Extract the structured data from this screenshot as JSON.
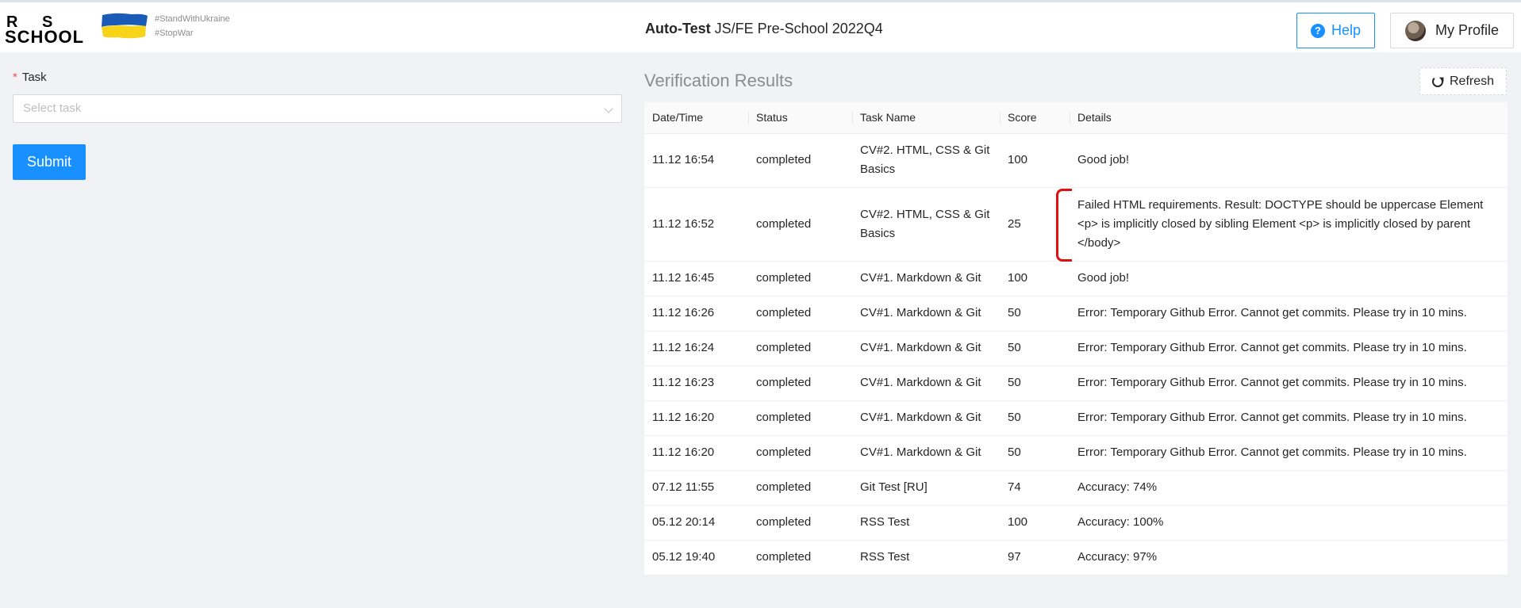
{
  "header": {
    "logo": {
      "r": "R",
      "s": "S",
      "school": "SCHOOL"
    },
    "tags": [
      "#StandWithUkraine",
      "#StopWar"
    ],
    "title_bold": "Auto-Test",
    "title_rest": " JS/FE Pre-School 2022Q4",
    "help_label": "Help",
    "help_icon_text": "?",
    "profile_label": "My Profile",
    "colors": {
      "accent": "#1890ff",
      "flag_blue": "#1a5bb8",
      "flag_yellow": "#f7d417"
    }
  },
  "form": {
    "required_mark": "*",
    "task_label": "Task",
    "task_placeholder": "Select task",
    "submit_label": "Submit"
  },
  "results": {
    "title": "Verification Results",
    "refresh_label": "Refresh",
    "columns": [
      "Date/Time",
      "Status",
      "Task Name",
      "Score",
      "Details"
    ],
    "rows": [
      {
        "date": "11.12 16:54",
        "status": "completed",
        "task": "CV#2. HTML, CSS & Git Basics",
        "score": "100",
        "details": "Good job!"
      },
      {
        "date": "11.12 16:52",
        "status": "completed",
        "task": "CV#2. HTML, CSS & Git Basics",
        "score": "25",
        "details": "Failed HTML requirements. Result: DOCTYPE should be uppercase Element <p> is implicitly closed by sibling Element <p> is implicitly closed by parent </body>"
      },
      {
        "date": "11.12 16:45",
        "status": "completed",
        "task": "CV#1. Markdown & Git",
        "score": "100",
        "details": "Good job!"
      },
      {
        "date": "11.12 16:26",
        "status": "completed",
        "task": "CV#1. Markdown & Git",
        "score": "50",
        "details": "Error: Temporary Github Error. Cannot get commits. Please try in 10 mins."
      },
      {
        "date": "11.12 16:24",
        "status": "completed",
        "task": "CV#1. Markdown & Git",
        "score": "50",
        "details": "Error: Temporary Github Error. Cannot get commits. Please try in 10 mins."
      },
      {
        "date": "11.12 16:23",
        "status": "completed",
        "task": "CV#1. Markdown & Git",
        "score": "50",
        "details": "Error: Temporary Github Error. Cannot get commits. Please try in 10 mins."
      },
      {
        "date": "11.12 16:20",
        "status": "completed",
        "task": "CV#1. Markdown & Git",
        "score": "50",
        "details": "Error: Temporary Github Error. Cannot get commits. Please try in 10 mins."
      },
      {
        "date": "11.12 16:20",
        "status": "completed",
        "task": "CV#1. Markdown & Git",
        "score": "50",
        "details": "Error: Temporary Github Error. Cannot get commits. Please try in 10 mins."
      },
      {
        "date": "07.12 11:55",
        "status": "completed",
        "task": "Git Test [RU]",
        "score": "74",
        "details": "Accuracy: 74%"
      },
      {
        "date": "05.12 20:14",
        "status": "completed",
        "task": "RSS Test",
        "score": "100",
        "details": "Accuracy: 100%"
      },
      {
        "date": "05.12 19:40",
        "status": "completed",
        "task": "RSS Test",
        "score": "97",
        "details": "Accuracy: 97%"
      }
    ]
  }
}
